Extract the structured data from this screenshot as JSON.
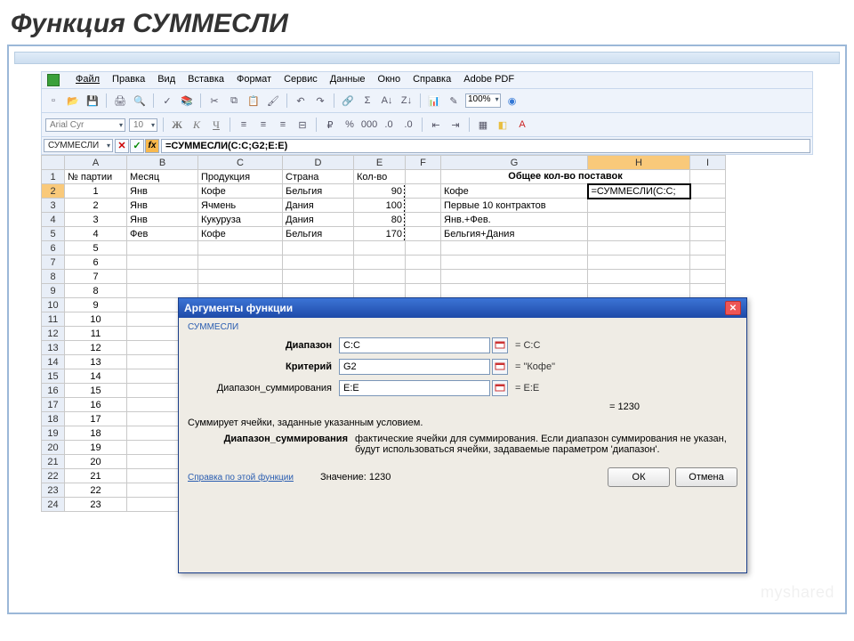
{
  "slide": {
    "title": "Функция СУММЕСЛИ"
  },
  "menu": {
    "items": [
      "Файл",
      "Правка",
      "Вид",
      "Вставка",
      "Формат",
      "Сервис",
      "Данные",
      "Окно",
      "Справка",
      "Adobe PDF"
    ]
  },
  "toolbar": {
    "font": "Arial Cyr",
    "fontsize": "10",
    "zoom": "100%",
    "b": "Ж",
    "i": "К",
    "u": "Ч"
  },
  "formula": {
    "namebox": "СУММЕСЛИ",
    "text": "=СУММЕСЛИ(C:C;G2;E:E)"
  },
  "columns": [
    "A",
    "B",
    "C",
    "D",
    "E",
    "F",
    "G",
    "H",
    "I"
  ],
  "headers": {
    "a": "№ партии",
    "b": "Месяц",
    "c": "Продукция",
    "d": "Страна",
    "e": "Кол-во",
    "g": "Общее кол-во поставок"
  },
  "rows": [
    {
      "n": "1",
      "a": "1",
      "b": "Янв",
      "c": "Кофе",
      "d": "Бельгия",
      "e": "90",
      "g": "Кофе",
      "h": "=СУММЕСЛИ(C:C;"
    },
    {
      "n": "2",
      "a": "2",
      "b": "Янв",
      "c": "Ячмень",
      "d": "Дания",
      "e": "100",
      "g": "Первые 10 контрактов",
      "h": ""
    },
    {
      "n": "3",
      "a": "3",
      "b": "Янв",
      "c": "Кукуруза",
      "d": "Дания",
      "e": "80",
      "g": "Янв.+Фев.",
      "h": ""
    },
    {
      "n": "4",
      "a": "4",
      "b": "Фев",
      "c": "Кофе",
      "d": "Бельгия",
      "e": "170",
      "g": "Бельгия+Дания",
      "h": ""
    }
  ],
  "extra_rows": [
    "5",
    "6",
    "7",
    "8",
    "9",
    "10",
    "11",
    "12",
    "13",
    "14",
    "15",
    "16",
    "17",
    "18",
    "19",
    "20",
    "21",
    "22",
    "23"
  ],
  "dialog": {
    "title": "Аргументы функции",
    "func": "СУММЕСЛИ",
    "args": [
      {
        "label": "Диапазон",
        "bold": true,
        "value": "C:C",
        "result": "= C:C"
      },
      {
        "label": "Критерий",
        "bold": true,
        "value": "G2",
        "result": "= \"Кофе\""
      },
      {
        "label": "Диапазон_суммирования",
        "bold": false,
        "value": "E:E",
        "result": "= E:E"
      }
    ],
    "equals_result": "= 1230",
    "desc": "Суммирует ячейки, заданные указанным условием.",
    "arg_name": "Диапазон_суммирования",
    "arg_text": "фактические ячейки для суммирования. Если диапазон суммирования не указан, будут использоваться ячейки, задаваемые параметром 'диапазон'.",
    "help": "Справка по этой функции",
    "value_label": "Значение:",
    "value": "1230",
    "ok": "ОК",
    "cancel": "Отмена"
  },
  "watermark": "myshared"
}
